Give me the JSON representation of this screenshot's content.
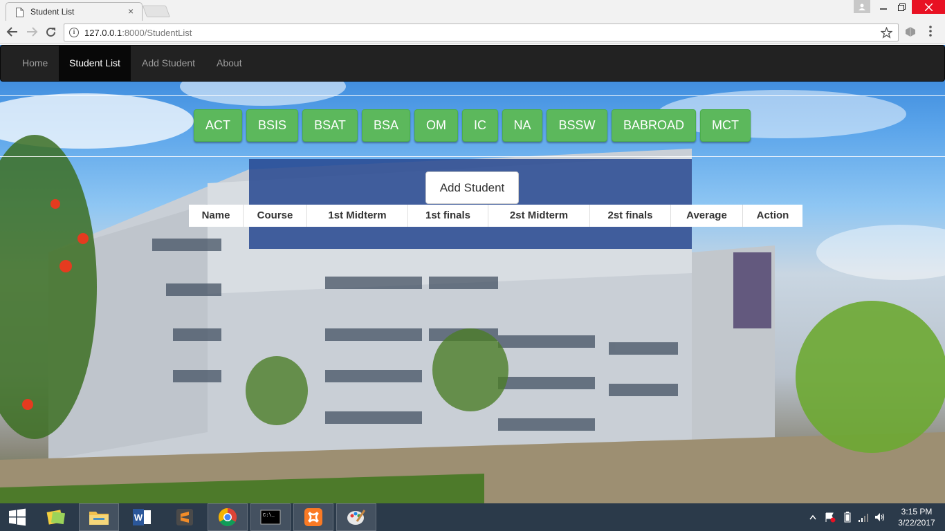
{
  "browser": {
    "tab_title": "Student List",
    "tab_close": "×",
    "url_host": "127.0.0.1",
    "url_rest": ":8000/StudentList"
  },
  "navbar": {
    "items": [
      {
        "label": "Home",
        "active": false
      },
      {
        "label": "Student List",
        "active": true
      },
      {
        "label": "Add Student",
        "active": false
      },
      {
        "label": "About",
        "active": false
      }
    ]
  },
  "courses": [
    "ACT",
    "BSIS",
    "BSAT",
    "BSA",
    "OM",
    "IC",
    "NA",
    "BSSW",
    "BABROAD",
    "MCT"
  ],
  "add_student_button": "Add Student",
  "table": {
    "headers": [
      "Name",
      "Course",
      "1st Midterm",
      "1st finals",
      "2st Midterm",
      "2st finals",
      "Average",
      "Action"
    ]
  },
  "taskbar": {
    "time": "3:15 PM",
    "date": "3/22/2017"
  },
  "colors": {
    "course_button": "#5cb85c",
    "navbar": "#222222",
    "taskbar": "#2b3a4a"
  }
}
